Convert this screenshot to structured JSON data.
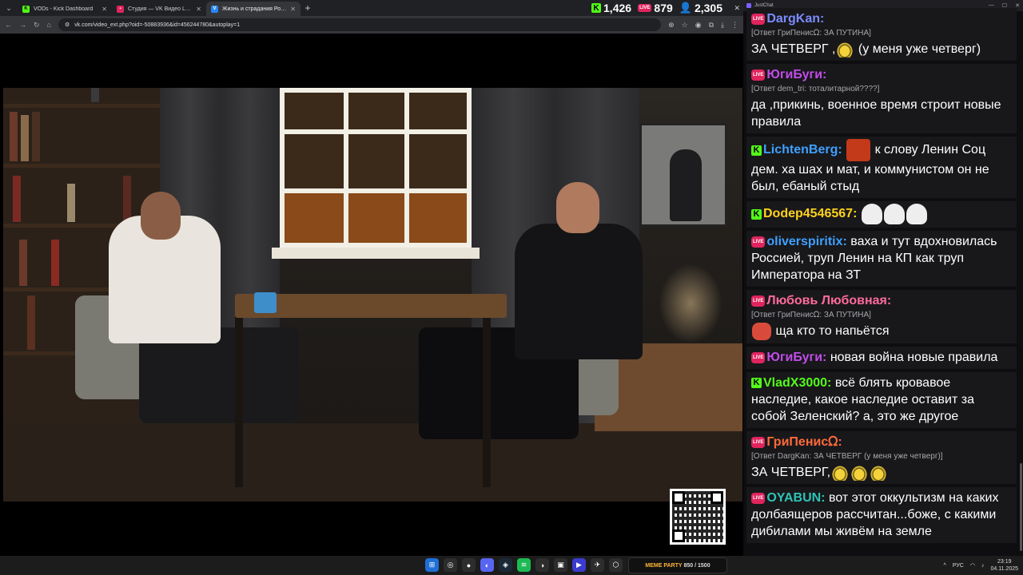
{
  "browser": {
    "tabs": [
      {
        "title": "VODs - Kick Dashboard",
        "fav_color": "#53fc18",
        "fav": "K"
      },
      {
        "title": "Студия — VK Видео Live",
        "fav_color": "#e0245e",
        "fav": "▪"
      },
      {
        "title": "Жизнь и страдания Рома...",
        "fav_color": "#2787f5",
        "fav": "V"
      }
    ],
    "new_tab": "+",
    "url": "vk.com/video_ext.php?oid=-50883936&id=456244780&autoplay=1"
  },
  "stats": {
    "kick_viewers": "1,426",
    "vk_viewers": "879",
    "total_viewers": "2,305",
    "kick_badge": "K",
    "live_badge": "LIVE",
    "viewer_icon": "person-icon"
  },
  "chat": {
    "title": "JustChat",
    "messages": [
      {
        "badge": "live",
        "user": "DargKan:",
        "color": "#7b8cff",
        "reply": "[Ответ ГриПенисᘯ: ЗА ПУТИНА]",
        "text_before": "ЗА ЧЕТВЕРГ ,",
        "emotes": [
          "egg"
        ],
        "text": "(у меня уже четверг)"
      },
      {
        "badge": "live",
        "user": "ЮгиБуги:",
        "color": "#c24ce8",
        "reply": "[Ответ dem_tri: тоталитарной????]",
        "text_before": "",
        "emotes": [],
        "text": "да ,прикинь, военное время строит новые правила"
      },
      {
        "badge": "kick",
        "user": "LichtenBerg:",
        "color": "#3fa0ff",
        "reply": "",
        "text_before": "",
        "emotes": [
          "lenin"
        ],
        "text": "к слову Ленин Соц дем. ха шах и мат, и коммунистом он не был, ебаный стыд"
      },
      {
        "badge": "kick",
        "user": "Dodep4546567:",
        "color": "#ffd21a",
        "reply": "",
        "text_before": "",
        "emotes": [
          "ghost",
          "ghost",
          "ghost"
        ],
        "text": ""
      },
      {
        "badge": "live",
        "user": "oliverspiritix:",
        "color": "#3fa0ff",
        "reply": "",
        "text_before": "",
        "emotes": [],
        "text": "ваха и тут вдохновилась Россией, труп Ленин на КП как труп Императора на ЗТ"
      },
      {
        "badge": "live",
        "user": "Любовь Любовная:",
        "color": "#ff6a9a",
        "reply": "[Ответ ГриПенисᘯ: ЗА ПУТИНА]",
        "text_before": "",
        "emotes": [
          "drink"
        ],
        "text": "ща кто то напьётся"
      },
      {
        "badge": "live",
        "user": "ЮгиБуги:",
        "color": "#c24ce8",
        "reply": "",
        "text_before": "",
        "emotes": [],
        "text": "новая война новые правила"
      },
      {
        "badge": "kick",
        "user": "VladX3000:",
        "color": "#53fc18",
        "reply": "",
        "text_before": "",
        "emotes": [],
        "text": "всё блять кровавое наследие, какое наследие оставит за собой Зеленский? а, это же другое"
      },
      {
        "badge": "live",
        "user": "ГриПенисᘯ:",
        "color": "#ff6a3a",
        "reply": "[Ответ DargKan: ЗА ЧЕТВЕРГ (у меня уже четверг)]",
        "text_before": "ЗА ЧЕТВЕРГ,",
        "emotes": [
          "egg",
          "egg",
          "egg"
        ],
        "text": ""
      },
      {
        "badge": "live",
        "user": "OYABUN:",
        "color": "#2ec4b6",
        "reply": "",
        "text_before": "",
        "emotes": [],
        "text": "вот этот оккультизм на каких долбаящеров рассчитан...боже, с какими дибилами мы живём на земле"
      }
    ]
  },
  "taskbar": {
    "banner": "MEME PARTY",
    "banner_progress": "850 / 1500",
    "lang": "РУС",
    "time": "23:19",
    "date": "04.11.2025"
  }
}
